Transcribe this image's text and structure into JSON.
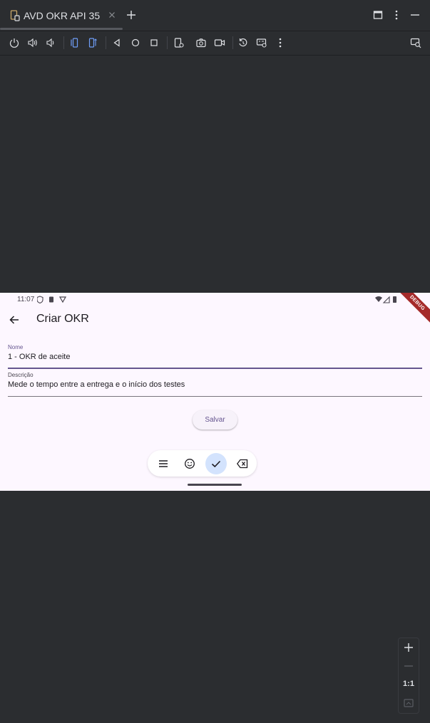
{
  "window": {
    "tab_title": "AVD OKR API 35"
  },
  "toolbar": {
    "buttons": [
      "power",
      "volume-up",
      "volume-down",
      "rotate-left",
      "rotate-right",
      "back",
      "home",
      "overview",
      "fold",
      "screenshot",
      "screen-record",
      "snapshot",
      "extended-controls",
      "more"
    ]
  },
  "device": {
    "status_time": "11:07",
    "debug_banner": "DEBUG",
    "app_title": "Criar OKR",
    "fields": [
      {
        "label": "Nome",
        "value": "1 - OKR de aceite",
        "focused": true
      },
      {
        "label": "Descrição",
        "value": "Mede o tempo entre a entrega e o início dos testes",
        "focused": false
      }
    ],
    "save_label": "Salvar",
    "accent_color": "#65558f"
  },
  "zoom": {
    "one_to_one_label": "1:1"
  }
}
